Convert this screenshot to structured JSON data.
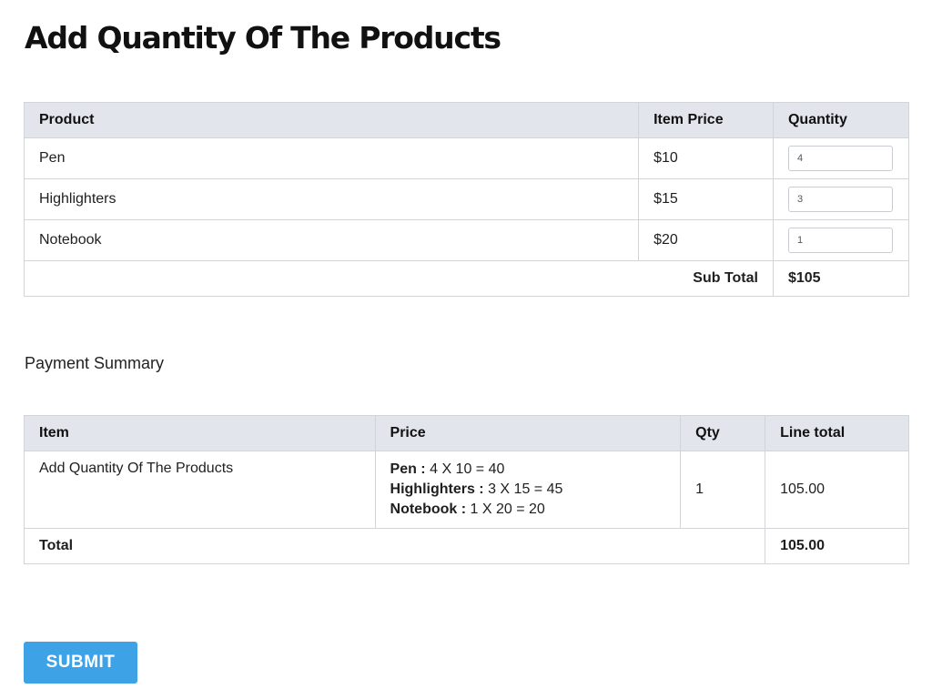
{
  "page": {
    "title": "Add Quantity Of The Products"
  },
  "products": {
    "headers": {
      "product": "Product",
      "price": "Item Price",
      "quantity": "Quantity"
    },
    "rows": [
      {
        "name": "Pen",
        "price": "$10",
        "quantity": "4"
      },
      {
        "name": "Highlighters",
        "price": "$15",
        "quantity": "3"
      },
      {
        "name": "Notebook",
        "price": "$20",
        "quantity": "1"
      }
    ],
    "subtotal_label": "Sub Total",
    "subtotal_value": "$105"
  },
  "summary": {
    "title": "Payment Summary",
    "headers": {
      "item": "Item",
      "price": "Price",
      "qty": "Qty",
      "line_total": "Line total"
    },
    "row": {
      "item": "Add Quantity Of The Products",
      "price_lines": [
        {
          "label": "Pen :",
          "calc": "4 X 10 = 40"
        },
        {
          "label": "Highlighters :",
          "calc": "3 X 15 = 45"
        },
        {
          "label": "Notebook :",
          "calc": "1 X 20 = 20"
        }
      ],
      "qty": "1",
      "line_total": "105.00"
    },
    "total_label": "Total",
    "total_value": "105.00"
  },
  "submit": {
    "label": "SUBMIT"
  }
}
